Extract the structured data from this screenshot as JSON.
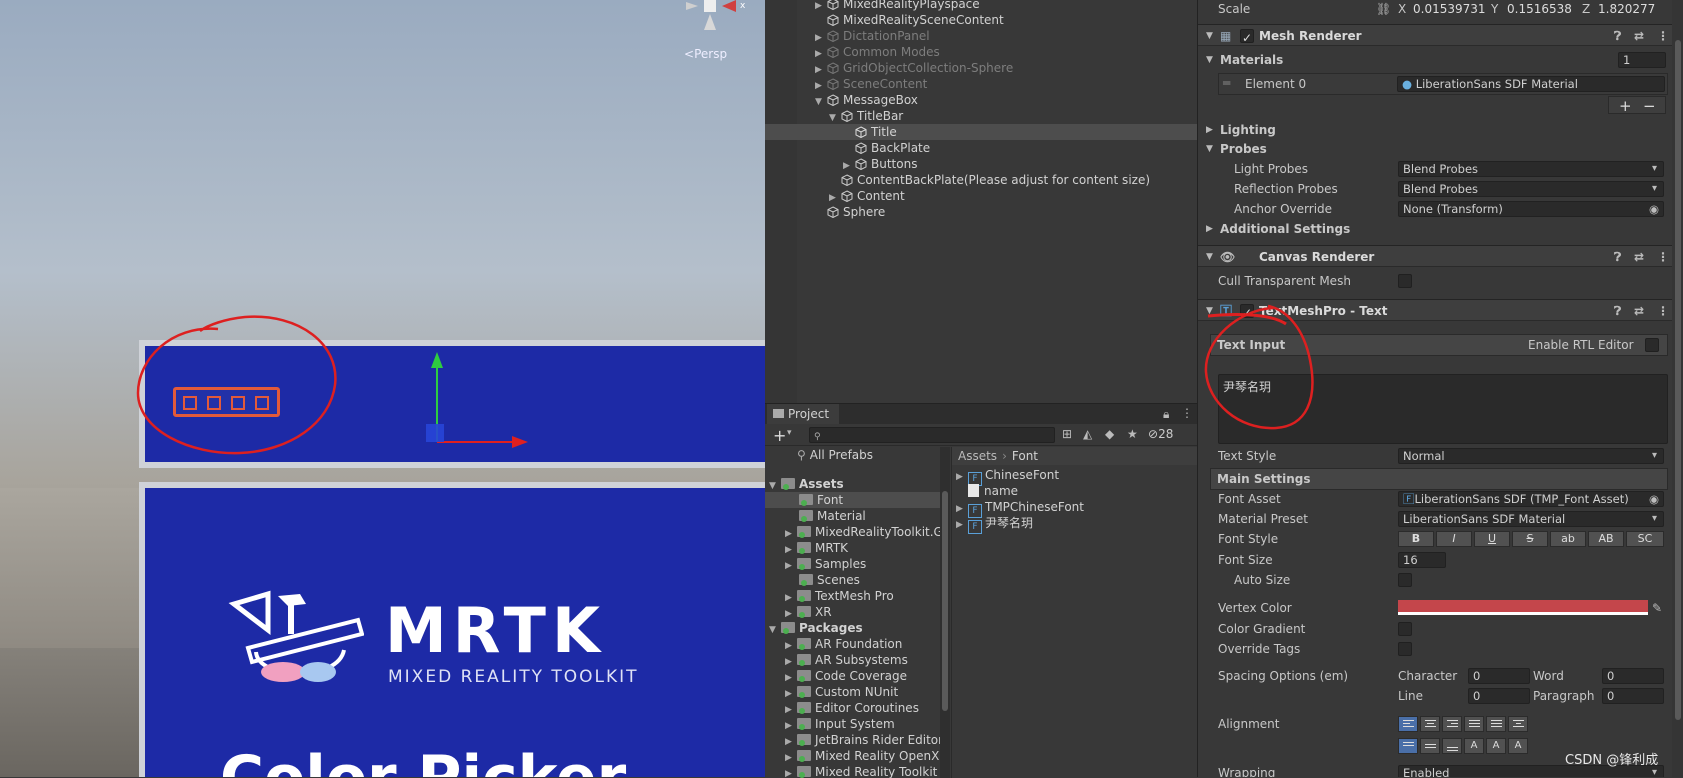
{
  "scene": {
    "persp_label": "Persp",
    "mrtk_title": "MRTK",
    "mrtk_subtitle": "MIXED REALITY TOOLKIT",
    "bottom_text": "Color Picker"
  },
  "hierarchy": {
    "items": [
      {
        "label": "MixedRealityPlayspace",
        "dim": false
      },
      {
        "label": "MixedRealitySceneContent",
        "dim": false
      },
      {
        "label": "DictationPanel",
        "dim": true
      },
      {
        "label": "Common Modes",
        "dim": true
      },
      {
        "label": "GridObjectCollection-Sphere",
        "dim": true
      },
      {
        "label": "SceneContent",
        "dim": true
      },
      {
        "label": "MessageBox",
        "dim": false
      },
      {
        "label": "TitleBar",
        "dim": false
      },
      {
        "label": "Title",
        "dim": false
      },
      {
        "label": "BackPlate",
        "dim": false
      },
      {
        "label": "Buttons",
        "dim": false
      },
      {
        "label": "ContentBackPlate(Please adjust for content size)",
        "dim": false
      },
      {
        "label": "Content",
        "dim": false
      },
      {
        "label": "Sphere",
        "dim": false
      }
    ]
  },
  "project": {
    "tab": "Project",
    "hidden_count": "28",
    "all_prefabs": "All Prefabs",
    "tree": [
      {
        "label": "Assets",
        "bold": true
      },
      {
        "label": "Font",
        "bold": false
      },
      {
        "label": "Material",
        "bold": false
      },
      {
        "label": "MixedRealityToolkit.Ge",
        "bold": false
      },
      {
        "label": "MRTK",
        "bold": false
      },
      {
        "label": "Samples",
        "bold": false
      },
      {
        "label": "Scenes",
        "bold": false
      },
      {
        "label": "TextMesh Pro",
        "bold": false
      },
      {
        "label": "XR",
        "bold": false
      },
      {
        "label": "Packages",
        "bold": true
      },
      {
        "label": "AR Foundation",
        "bold": false
      },
      {
        "label": "AR Subsystems",
        "bold": false
      },
      {
        "label": "Code Coverage",
        "bold": false
      },
      {
        "label": "Custom NUnit",
        "bold": false
      },
      {
        "label": "Editor Coroutines",
        "bold": false
      },
      {
        "label": "Input System",
        "bold": false
      },
      {
        "label": "JetBrains Rider Editor",
        "bold": false
      },
      {
        "label": "Mixed Reality OpenXR",
        "bold": false
      },
      {
        "label": "Mixed Reality Toolkit E",
        "bold": false
      }
    ],
    "breadcrumb": [
      "Assets",
      "Font"
    ],
    "files": [
      "ChineseFont",
      "name",
      "TMPChineseFont",
      "尹琴名玥"
    ]
  },
  "inspector": {
    "scale": {
      "label": "Scale",
      "x": "0.01539731",
      "y": "0.1516538",
      "z": "1.820277",
      "xl": "X",
      "yl": "Y",
      "zl": "Z"
    },
    "mesh_renderer": {
      "title": "Mesh Renderer",
      "materials_label": "Materials",
      "materials_count": "1",
      "element_label": "Element 0",
      "element_value": "LiberationSans SDF Material",
      "lighting": "Lighting",
      "probes": "Probes",
      "light_probes_label": "Light Probes",
      "light_probes_value": "Blend Probes",
      "reflection_probes_label": "Reflection Probes",
      "reflection_probes_value": "Blend Probes",
      "anchor_label": "Anchor Override",
      "anchor_value": "None (Transform)",
      "additional": "Additional Settings"
    },
    "canvas_renderer": {
      "title": "Canvas Renderer",
      "cull_label": "Cull Transparent Mesh"
    },
    "tmp": {
      "title": "TextMeshPro - Text",
      "text_input_label": "Text Input",
      "rtl_label": "Enable RTL Editor",
      "text_value": "尹琴名玥",
      "text_style_label": "Text Style",
      "text_style_value": "Normal",
      "main_settings": "Main Settings",
      "font_asset_label": "Font Asset",
      "font_asset_value": "LiberationSans SDF (TMP_Font Asset)",
      "material_preset_label": "Material Preset",
      "material_preset_value": "LiberationSans SDF Material",
      "font_style_label": "Font Style",
      "font_style_buttons": [
        "B",
        "I",
        "U",
        "S",
        "ab",
        "AB",
        "SC"
      ],
      "font_size_label": "Font Size",
      "font_size_value": "16",
      "auto_size_label": "Auto Size",
      "vertex_color_label": "Vertex Color",
      "vertex_color": "#c4464b",
      "color_gradient_label": "Color Gradient",
      "override_tags_label": "Override Tags",
      "spacing_label": "Spacing Options (em)",
      "character_label": "Character",
      "character_value": "0",
      "word_label": "Word",
      "word_value": "0",
      "line_label": "Line",
      "line_value": "0",
      "paragraph_label": "Paragraph",
      "paragraph_value": "0",
      "alignment_label": "Alignment",
      "wrapping_label": "Wrapping",
      "wrapping_value": "Enabled"
    }
  },
  "watermark": "CSDN @锋利成"
}
